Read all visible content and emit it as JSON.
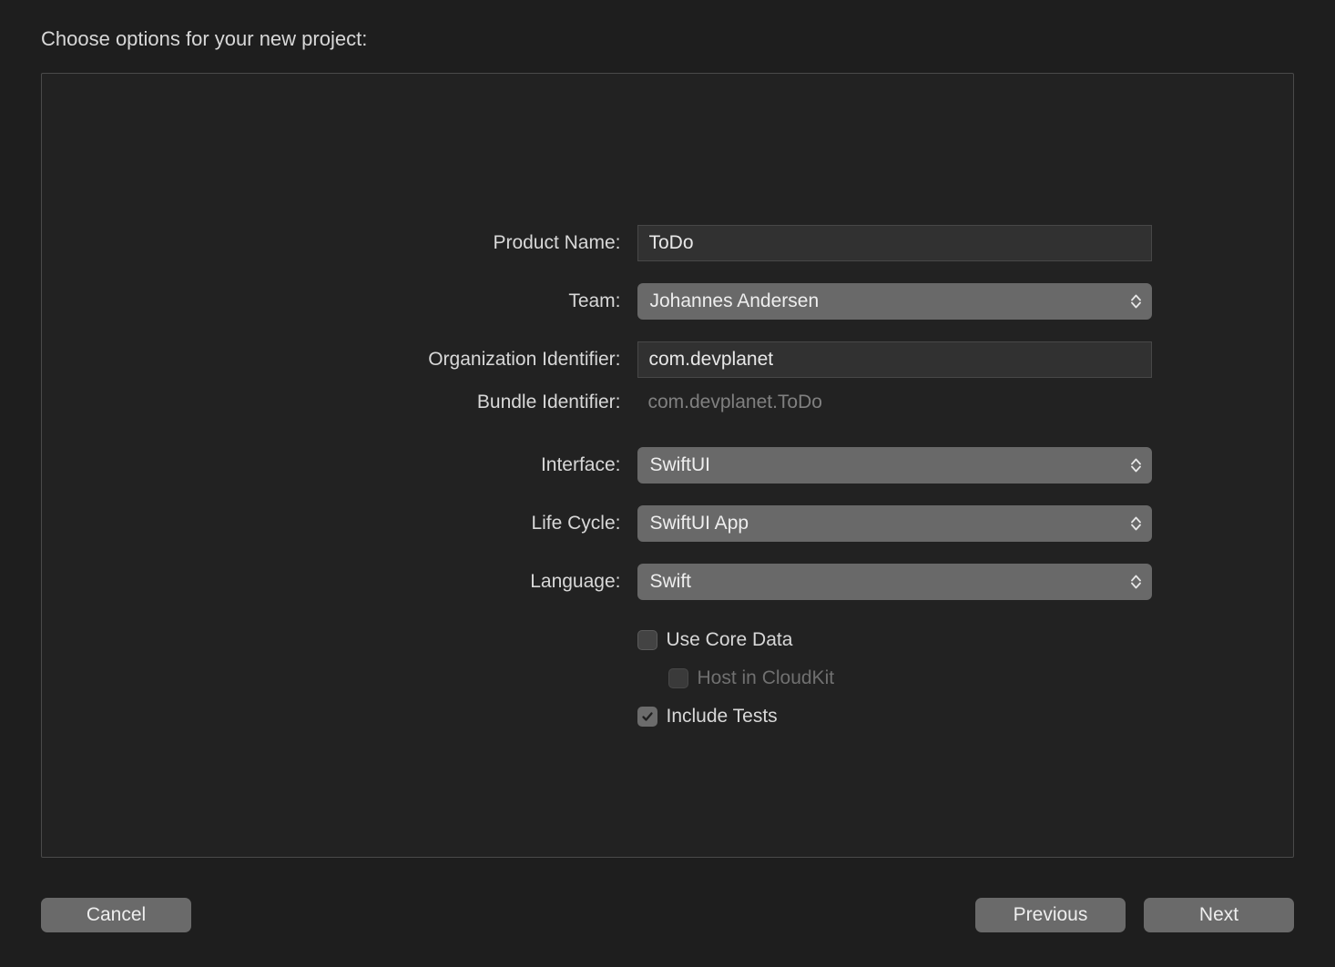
{
  "header": {
    "title": "Choose options for your new project:"
  },
  "form": {
    "productName": {
      "label": "Product Name:",
      "value": "ToDo"
    },
    "team": {
      "label": "Team:",
      "value": "Johannes Andersen"
    },
    "organizationIdentifier": {
      "label": "Organization Identifier:",
      "value": "com.devplanet"
    },
    "bundleIdentifier": {
      "label": "Bundle Identifier:",
      "value": "com.devplanet.ToDo"
    },
    "interface": {
      "label": "Interface:",
      "value": "SwiftUI"
    },
    "lifeCycle": {
      "label": "Life Cycle:",
      "value": "SwiftUI App"
    },
    "language": {
      "label": "Language:",
      "value": "Swift"
    },
    "useCoreData": {
      "label": "Use Core Data",
      "checked": false
    },
    "hostInCloudKit": {
      "label": "Host in CloudKit",
      "checked": false,
      "disabled": true
    },
    "includeTests": {
      "label": "Include Tests",
      "checked": true
    }
  },
  "footer": {
    "cancel": "Cancel",
    "previous": "Previous",
    "next": "Next"
  }
}
